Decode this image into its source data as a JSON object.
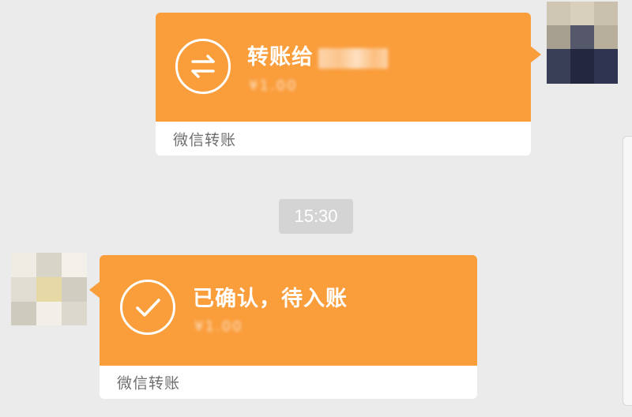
{
  "messages": [
    {
      "direction": "outgoing",
      "type": "wechat-transfer",
      "title": "转账给",
      "recipient_name": "",
      "amount": "¥1.00",
      "footer": "微信转账",
      "icon": "transfer-arrows-icon",
      "color": "#fa9d3b"
    },
    {
      "direction": "incoming",
      "type": "wechat-transfer",
      "title": "已确认，待入账",
      "amount": "¥1.00",
      "footer": "微信转账",
      "icon": "checkmark-icon",
      "color": "#fa9d3b"
    }
  ],
  "timestamp": "15:30"
}
